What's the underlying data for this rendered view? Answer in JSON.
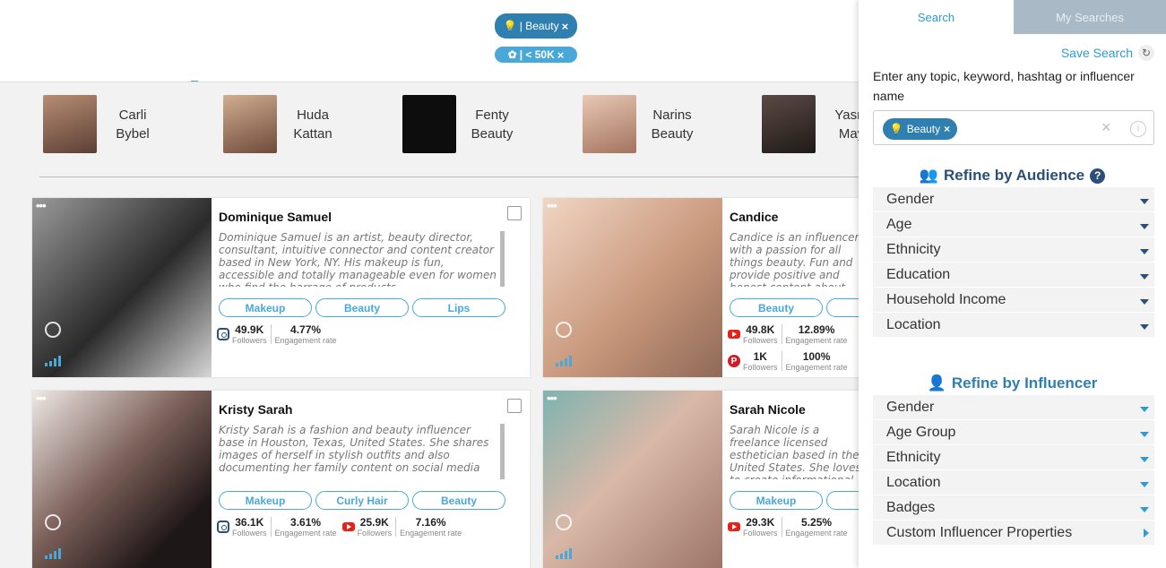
{
  "filters_bar": {
    "topic_pill": "| Beauty",
    "followers_pill": "| < 50K"
  },
  "similar": [
    {
      "line1": "Carli",
      "line2": "Bybel",
      "color": "#7a5a4a"
    },
    {
      "line1": "Huda",
      "line2": "Kattan",
      "color": "#b08870"
    },
    {
      "line1": "Fenty",
      "line2": "Beauty",
      "color": "#111111"
    },
    {
      "line1": "Narins",
      "line2": "Beauty",
      "color": "#c4a08a"
    },
    {
      "line1": "Yasm",
      "line2": "May",
      "color": "#3a2e2a"
    }
  ],
  "cards": [
    {
      "name": "Dominique Samuel",
      "bio": "Dominique Samuel is an artist, beauty director, consultant, intuitive connector and content creator based in New York, NY. His makeup is fun, accessible and totally manageable even for women who find the barrage of products",
      "tags": [
        "Makeup",
        "Beauty",
        "Lips"
      ],
      "stats": [
        {
          "icon": "instagram-icon",
          "value": "49.9K",
          "label": "Followers",
          "rate": "4.77%",
          "rate_label": "Engagement rate"
        }
      ],
      "photo": "#3a3a3a"
    },
    {
      "name": "Candice",
      "bio": "Candice is an influencer with a passion for all things beauty. Fun and provide positive and honest content about makeup, hair and",
      "tags": [
        "Beauty",
        "M"
      ],
      "stats": [
        {
          "icon": "youtube-icon",
          "value": "49.8K",
          "label": "Followers",
          "rate": "12.89%",
          "rate_label": "Engagement rate"
        },
        {
          "icon": "pinterest-icon",
          "value": "1K",
          "label": "Followers",
          "rate": "100%",
          "rate_label": "Engagement rate"
        }
      ],
      "photo": "#c9a48c"
    },
    {
      "name": "Kristy Sarah",
      "bio": "Kristy Sarah is a fashion and beauty influencer base in Houston, Texas, United States. She shares images of herself in stylish outfits and also documenting her family content on social media",
      "tags": [
        "Makeup",
        "Curly Hair",
        "Beauty"
      ],
      "stats": [
        {
          "icon": "instagram-icon",
          "value": "36.1K",
          "label": "Followers",
          "rate": "3.61%",
          "rate_label": "Engagement rate"
        },
        {
          "icon": "youtube-icon",
          "value": "25.9K",
          "label": "Followers",
          "rate": "7.16%",
          "rate_label": "Engagement rate"
        }
      ],
      "photo": "#6a5450"
    },
    {
      "name": "Sarah Nicole",
      "bio": "Sarah Nicole is a freelance licensed esthetician based in the United States. She loves to create informational videos, tutorials and reviews",
      "tags": [
        "Makeup",
        "B"
      ],
      "stats": [
        {
          "icon": "youtube-icon",
          "value": "29.3K",
          "label": "Followers",
          "rate": "5.25%",
          "rate_label": "Engagement rate"
        }
      ],
      "photo": "#b8988a"
    }
  ],
  "panel": {
    "tab_search": "Search",
    "tab_my_searches": "My Searches",
    "save_search": "Save Search",
    "help_text": "Enter any topic, keyword, hashtag or influencer name",
    "chip": "Beauty",
    "audience_title": "Refine by Audience",
    "audience_filters": [
      "Gender",
      "Age",
      "Ethnicity",
      "Education",
      "Household Income",
      "Location"
    ],
    "influencer_title": "Refine by Influencer",
    "influencer_filters": [
      "Gender",
      "Age Group",
      "Ethnicity",
      "Location",
      "Badges",
      "Custom Influencer Properties"
    ]
  },
  "colors": {
    "accent": "#2f9ad3",
    "navy": "#2b4f78",
    "pill": "#2f7fb0"
  }
}
